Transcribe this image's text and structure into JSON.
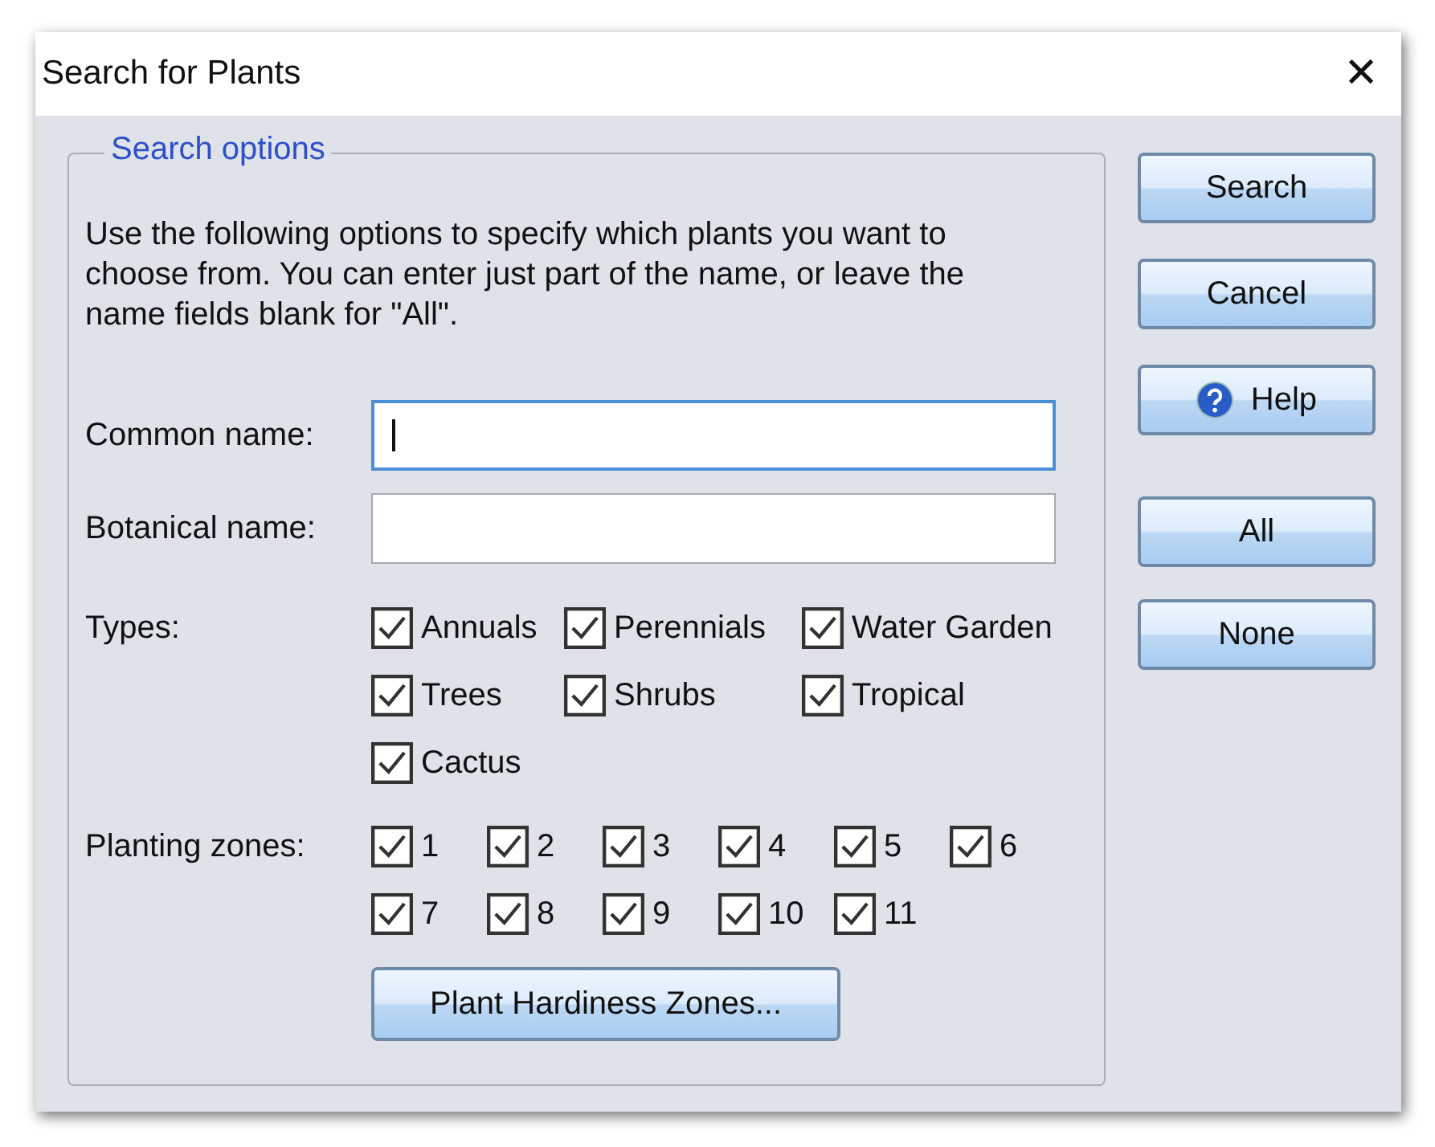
{
  "window": {
    "title": "Search for Plants",
    "close": "✕"
  },
  "group": {
    "title": "Search options",
    "description": "Use the following options to specify which plants you want to choose from. You can enter just part of the name, or leave the name fields blank for \"All\".",
    "fields": [
      {
        "label": "Common name:",
        "focused": true
      },
      {
        "label": "Botanical name:",
        "focused": false
      }
    ],
    "types": {
      "label": "Types:",
      "items": [
        {
          "label": "Annuals",
          "checked": true
        },
        {
          "label": "Perennials",
          "checked": true
        },
        {
          "label": "Water Garden",
          "checked": true
        },
        {
          "label": "Trees",
          "checked": true
        },
        {
          "label": "Shrubs",
          "checked": true
        },
        {
          "label": "Tropical",
          "checked": true
        },
        {
          "label": "Cactus",
          "checked": true
        }
      ]
    },
    "zones": {
      "label": "Planting zones:",
      "items": [
        {
          "label": "1",
          "checked": true
        },
        {
          "label": "2",
          "checked": true
        },
        {
          "label": "3",
          "checked": true
        },
        {
          "label": "4",
          "checked": true
        },
        {
          "label": "5",
          "checked": true
        },
        {
          "label": "6",
          "checked": true
        },
        {
          "label": "7",
          "checked": true
        },
        {
          "label": "8",
          "checked": true
        },
        {
          "label": "9",
          "checked": true
        },
        {
          "label": "10",
          "checked": true
        },
        {
          "label": "11",
          "checked": true
        }
      ]
    },
    "hardiness_button": "Plant Hardiness Zones..."
  },
  "action_buttons": [
    {
      "label": "Search",
      "kind": "plain"
    },
    {
      "label": "Cancel",
      "kind": "plain"
    },
    {
      "label": "Help",
      "kind": "help"
    }
  ],
  "select_buttons": [
    {
      "label": "All"
    },
    {
      "label": "None"
    }
  ]
}
